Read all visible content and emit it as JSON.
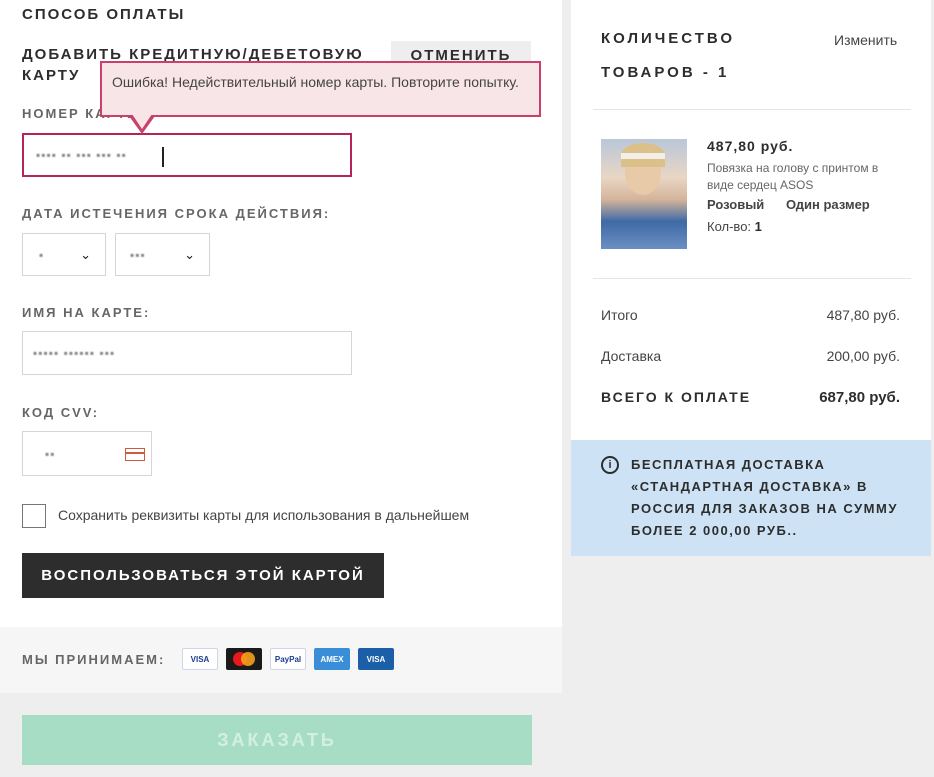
{
  "payment": {
    "section_title": "СПОСОБ ОПЛАТЫ",
    "add_card_title": "ДОБАВИТЬ КРЕДИТНУЮ/ДЕБЕТОВУЮ КАРТУ",
    "cancel_label": "ОТМЕНИТЬ",
    "error_message": "Ошибка! Недействительный номер карты. Повторите попытку.",
    "card_number_label": "НОМЕР КАРТЫ:",
    "card_number_value": "▪▪▪▪ ▪▪ ▪▪▪ ▪▪▪ ▪▪",
    "expiry_label": "ДАТА ИСТЕЧЕНИЯ СРОКА ДЕЙСТВИЯ:",
    "expiry_month_value": "▪",
    "expiry_year_value": "▪▪▪",
    "name_label": "ИМЯ НА КАРТЕ:",
    "name_value": "▪▪▪▪▪ ▪▪▪▪▪▪ ▪▪▪",
    "cvv_label": "КОД CVV:",
    "cvv_value": "▪▪",
    "save_card_label": "Сохранить реквизиты карты для использования в дальнейшем",
    "use_card_label": "ВОСПОЛЬЗОВАТЬСЯ ЭТОЙ КАРТОЙ",
    "accept_label": "МЫ ПРИНИМАЕМ:",
    "card_logos": [
      {
        "name": "visa",
        "text": "VISA",
        "bg": "#ffffff",
        "fg": "#1a3d8f",
        "border": "#cfd6e6"
      },
      {
        "name": "mastercard",
        "text": "",
        "bg": "#1a1a1a",
        "fg": "#ffffff",
        "border": "#1a1a1a"
      },
      {
        "name": "paypal",
        "text": "PayPal",
        "bg": "#ffffff",
        "fg": "#1a3d8f",
        "border": "#cfd6e6"
      },
      {
        "name": "amex",
        "text": "AMEX",
        "bg": "#3a8ed8",
        "fg": "#ffffff",
        "border": "#3a8ed8"
      },
      {
        "name": "visa-electron",
        "text": "VISA",
        "bg": "#1a5fa8",
        "fg": "#ffffff",
        "border": "#1a5fa8"
      }
    ],
    "order_label": "ЗАКАЗАТЬ"
  },
  "summary": {
    "title_line1": "КОЛИЧЕСТВО",
    "title_line2": "ТОВАРОВ - 1",
    "change_label": "Изменить",
    "product": {
      "price": "487,80 руб.",
      "name": "Повязка на голову с принтом в виде сердец ASOS",
      "color": "Розовый",
      "size": "Один размер",
      "qty_label": "Кол-во:",
      "qty_value": "1"
    },
    "subtotal_label": "Итого",
    "subtotal_value": "487,80 руб.",
    "delivery_label": "Доставка",
    "delivery_value": "200,00 руб.",
    "total_label": "ВСЕГО К ОПЛАТЕ",
    "total_value": "687,80 руб.",
    "info_text": "БЕСПЛАТНАЯ ДОСТАВКА «СТАНДАРТНАЯ ДОСТАВКА» В РОССИЯ ДЛЯ ЗАКАЗОВ НА СУММУ БОЛЕЕ 2 000,00 РУБ.."
  },
  "colors": {
    "error_border": "#b6235a",
    "order_button": "#a7ddc4",
    "info_bg": "#cde3f5",
    "dark_button": "#2d2d2d"
  }
}
